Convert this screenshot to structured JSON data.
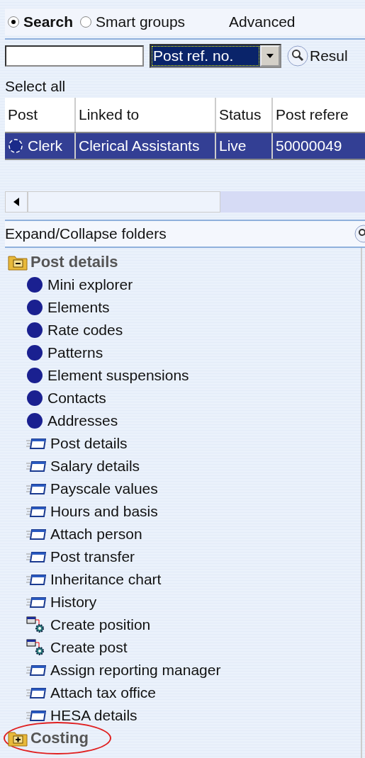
{
  "search_modes": [
    {
      "label": "Search",
      "selected": true
    },
    {
      "label": "Smart groups",
      "selected": false
    }
  ],
  "advanced_link": "Advanced",
  "search": {
    "field": "Post ref. no.",
    "button": "Resul"
  },
  "select_all": "Select all",
  "table": {
    "columns": [
      "Post",
      "Linked to",
      "Status",
      "Post refere"
    ],
    "rows": [
      {
        "cells": [
          "Clerk",
          "Clerical Assistants",
          "Live",
          "50000049"
        ],
        "selected": true
      }
    ]
  },
  "expand_collapse": "Expand/Collapse folders",
  "tree": [
    {
      "label": "Post details",
      "expanded": true,
      "circled": false,
      "children": [
        {
          "label": "Mini explorer",
          "kind": "dot"
        },
        {
          "label": "Elements",
          "kind": "dot"
        },
        {
          "label": "Rate codes",
          "kind": "dot"
        },
        {
          "label": "Patterns",
          "kind": "dot"
        },
        {
          "label": "Element suspensions",
          "kind": "dot"
        },
        {
          "label": "Contacts",
          "kind": "dot"
        },
        {
          "label": "Addresses",
          "kind": "dot"
        },
        {
          "label": "Post details",
          "kind": "form"
        },
        {
          "label": "Salary details",
          "kind": "form"
        },
        {
          "label": "Payscale values",
          "kind": "form"
        },
        {
          "label": "Hours and basis",
          "kind": "form"
        },
        {
          "label": "Attach person",
          "kind": "form"
        },
        {
          "label": "Post transfer",
          "kind": "form"
        },
        {
          "label": "Inheritance chart",
          "kind": "form"
        },
        {
          "label": "History",
          "kind": "form"
        },
        {
          "label": "Create position",
          "kind": "action"
        },
        {
          "label": "Create post",
          "kind": "action"
        },
        {
          "label": "Assign reporting manager",
          "kind": "form"
        },
        {
          "label": "Attach tax office",
          "kind": "form"
        },
        {
          "label": "HESA details",
          "kind": "form"
        }
      ]
    },
    {
      "label": "Costing",
      "expanded": false,
      "circled": true
    }
  ]
}
